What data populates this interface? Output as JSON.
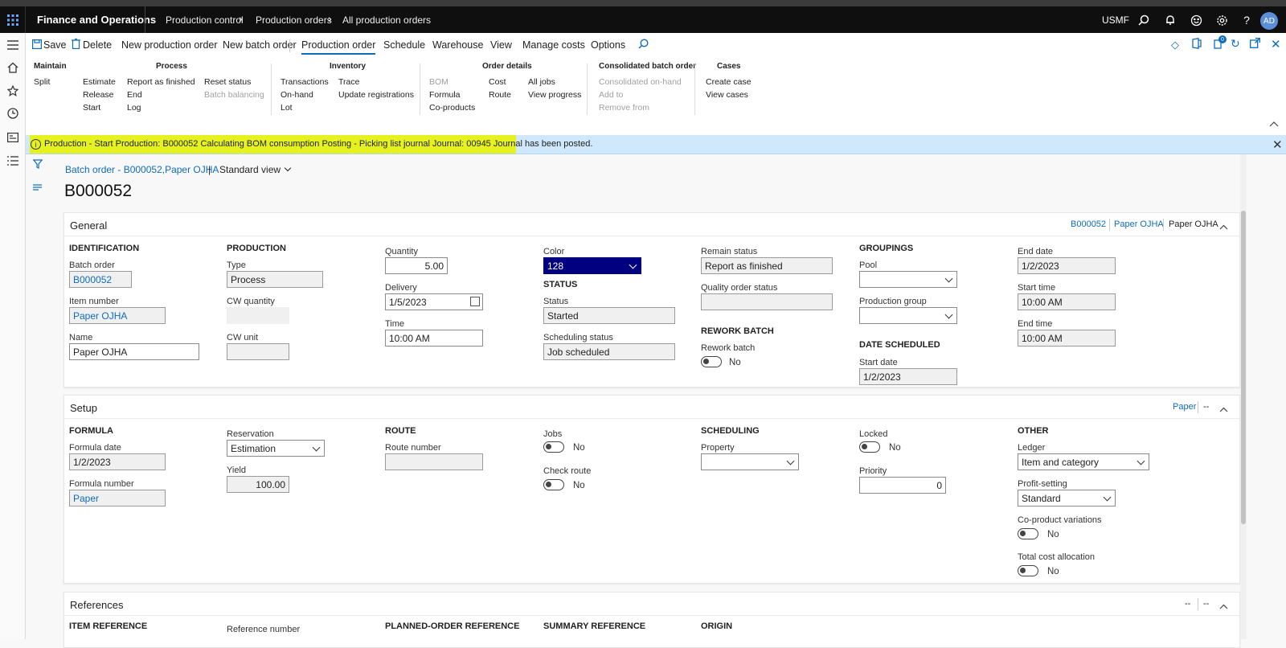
{
  "topbar": {
    "app_title": "Finance and Operations",
    "breadcrumb": [
      "Production control",
      "Production orders",
      "All production orders"
    ],
    "company": "USMF",
    "avatar_initials": "AD"
  },
  "toolbar": {
    "save": "Save",
    "delete": "Delete",
    "new_production_order": "New production order",
    "new_batch_order": "New batch order",
    "tabs": [
      "Production order",
      "Schedule",
      "Warehouse",
      "View",
      "Manage costs",
      "Options"
    ],
    "active_tab": "Production order"
  },
  "ribbon": {
    "maintain": {
      "title": "Maintain",
      "items": [
        "Split"
      ]
    },
    "process": {
      "title": "Process",
      "col1": [
        "Estimate",
        "Release",
        "Start"
      ],
      "col2": [
        "Report as finished",
        "End",
        "Log"
      ],
      "col3": [
        "Reset status",
        "Batch balancing"
      ]
    },
    "inventory": {
      "title": "Inventory",
      "col1": [
        "Transactions",
        "On-hand",
        "Lot"
      ],
      "col2": [
        "Trace",
        "Update registrations"
      ]
    },
    "order_details": {
      "title": "Order details",
      "col1": [
        "BOM",
        "Formula",
        "Co-products"
      ],
      "col2": [
        "Cost",
        "Route"
      ],
      "col3": [
        "All jobs",
        "View progress"
      ]
    },
    "consolidated": {
      "title": "Consolidated batch order",
      "items": [
        "Consolidated on-hand",
        "Add to",
        "Remove from"
      ]
    },
    "cases": {
      "title": "Cases",
      "items": [
        "Create case",
        "View cases"
      ]
    }
  },
  "message": "Production - Start  Production: B000052 Calculating BOM consumption Posting - Picking list journal Journal: 00945 Journal has been posted.",
  "page": {
    "breadcrumb": "Batch order - B000052,Paper OJHA",
    "separator": "|",
    "view": "Standard view",
    "record_id": "B000052"
  },
  "general": {
    "title": "General",
    "summary": [
      "B000052",
      "Paper OJHA",
      "Paper OJHA"
    ],
    "identification": {
      "heading": "IDENTIFICATION",
      "batch_order_label": "Batch order",
      "batch_order": "B000052",
      "item_number_label": "Item number",
      "item_number": "Paper OJHA",
      "name_label": "Name",
      "name": "Paper OJHA"
    },
    "production": {
      "heading": "PRODUCTION",
      "type_label": "Type",
      "type": "Process",
      "cw_quantity_label": "CW quantity",
      "cw_unit_label": "CW unit"
    },
    "quantity": {
      "quantity_label": "Quantity",
      "quantity": "5.00",
      "delivery_label": "Delivery",
      "delivery": "1/5/2023",
      "time_label": "Time",
      "time": "10:00 AM"
    },
    "color": {
      "color_label": "Color",
      "color": "128",
      "status_heading": "STATUS",
      "status_label": "Status",
      "status": "Started",
      "scheduling_status_label": "Scheduling status",
      "scheduling_status": "Job scheduled"
    },
    "remain": {
      "remain_status_label": "Remain status",
      "remain_status": "Report as finished",
      "quality_order_status_label": "Quality order status",
      "rework_heading": "REWORK BATCH",
      "rework_batch_label": "Rework batch",
      "rework_batch": "No"
    },
    "groupings": {
      "heading": "GROUPINGS",
      "pool_label": "Pool",
      "production_group_label": "Production group",
      "date_scheduled_heading": "DATE SCHEDULED",
      "start_date_label": "Start date",
      "start_date": "1/2/2023"
    },
    "dates": {
      "end_date_label": "End date",
      "end_date": "1/2/2023",
      "start_time_label": "Start time",
      "start_time": "10:00 AM",
      "end_time_label": "End time",
      "end_time": "10:00 AM"
    }
  },
  "setup": {
    "title": "Setup",
    "summary": [
      "Paper",
      "--"
    ],
    "formula": {
      "heading": "FORMULA",
      "formula_date_label": "Formula date",
      "formula_date": "1/2/2023",
      "formula_number_label": "Formula number",
      "formula_number": "Paper"
    },
    "reservation": {
      "reservation_label": "Reservation",
      "reservation": "Estimation",
      "yield_label": "Yield",
      "yield": "100.00"
    },
    "route": {
      "heading": "ROUTE",
      "route_number_label": "Route number"
    },
    "jobs": {
      "jobs_label": "Jobs",
      "jobs": "No",
      "check_route_label": "Check route",
      "check_route": "No"
    },
    "scheduling": {
      "heading": "SCHEDULING",
      "property_label": "Property"
    },
    "locked": {
      "locked_label": "Locked",
      "locked": "No",
      "priority_label": "Priority",
      "priority": "0"
    },
    "other": {
      "heading": "OTHER",
      "ledger_label": "Ledger",
      "ledger": "Item and category",
      "profit_setting_label": "Profit-setting",
      "profit_setting": "Standard",
      "co_product_variations_label": "Co-product variations",
      "co_product_variations": "No",
      "total_cost_allocation_label": "Total cost allocation",
      "total_cost_allocation": "No"
    }
  },
  "references": {
    "title": "References",
    "summary": [
      "--",
      "--"
    ],
    "item_reference_heading": "ITEM REFERENCE",
    "reference_number_label": "Reference number",
    "planned_order_heading": "PLANNED-ORDER REFERENCE",
    "summary_reference_heading": "SUMMARY REFERENCE",
    "origin_heading": "ORIGIN"
  }
}
